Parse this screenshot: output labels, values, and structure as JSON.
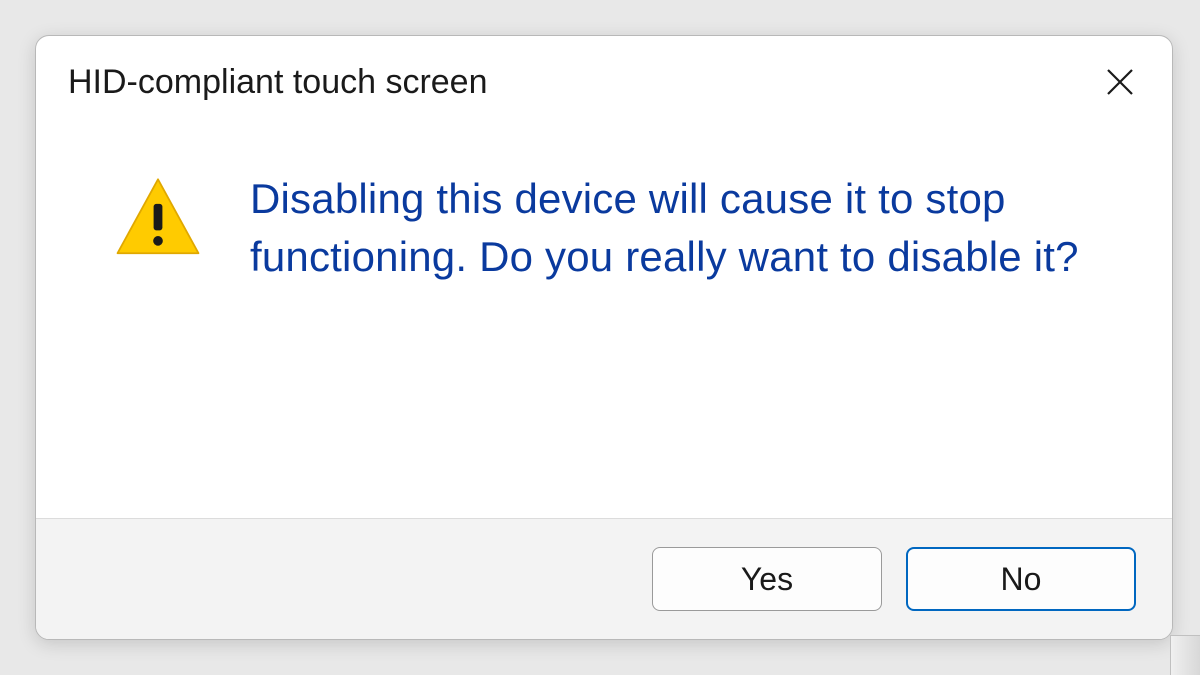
{
  "dialog": {
    "title": "HID-compliant touch screen",
    "message": "Disabling this device will cause it to stop functioning. Do you really want to disable it?",
    "buttons": {
      "yes": "Yes",
      "no": "No"
    },
    "icon": "warning-icon",
    "colors": {
      "message_text": "#0a3a9e",
      "warning_fill": "#ffcb00",
      "warning_stroke": "#e0a800",
      "default_button_border": "#0067c0"
    }
  }
}
